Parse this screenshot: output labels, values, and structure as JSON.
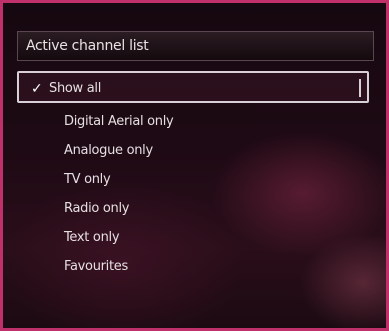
{
  "dialog": {
    "title": "Active channel list",
    "items": [
      {
        "label": "Show all",
        "selected": true
      },
      {
        "label": "Digital Aerial only",
        "selected": false
      },
      {
        "label": "Analogue only",
        "selected": false
      },
      {
        "label": "TV only",
        "selected": false
      },
      {
        "label": "Radio only",
        "selected": false
      },
      {
        "label": "Text only",
        "selected": false
      },
      {
        "label": "Favourites",
        "selected": false
      }
    ],
    "check_glyph": "✓"
  },
  "colors": {
    "frame_border": "#c0306a",
    "background": "#1a0a10",
    "text": "#e6dfe2",
    "selection_border": "#d8d0d4"
  }
}
